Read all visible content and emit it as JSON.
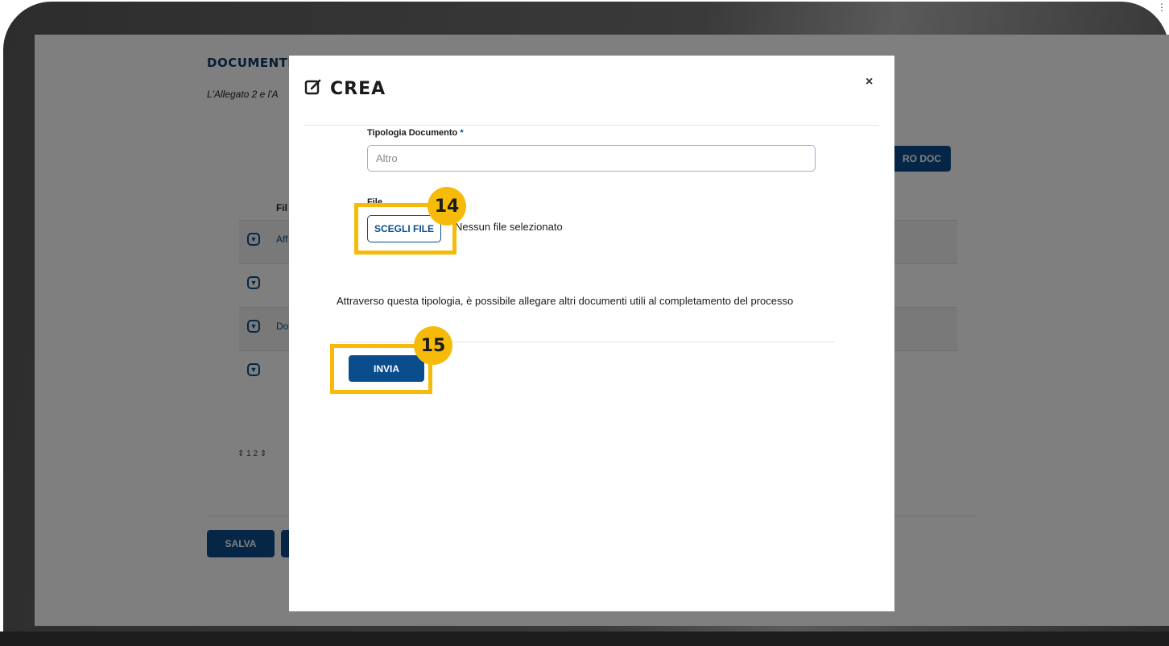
{
  "background": {
    "section_title": "DOCUMENTI",
    "subtitle": "L'Allegato 2 e l'A",
    "add_doc_button": "RO DOC",
    "table_header_fragment": "Fil",
    "rows": [
      {
        "text": "Aff"
      },
      {
        "text": ""
      },
      {
        "text": "Do"
      },
      {
        "text": ""
      }
    ],
    "pagination": "1 2",
    "save_button": "SALVA"
  },
  "modal": {
    "title": "CREA",
    "close_label": "×",
    "doc_type_label": "Tipologia Documento",
    "required_mark": "*",
    "doc_type_placeholder": "Altro",
    "file_label": "File",
    "choose_file_button": "SCEGLI FILE",
    "no_file_text": "Nessun file selezionato",
    "description": "Attraverso questa tipologia, è possibile allegare altri documenti utili al completamento del processo",
    "send_button": "INVIA"
  },
  "callouts": [
    {
      "number": "14"
    },
    {
      "number": "15"
    }
  ],
  "colors": {
    "accent": "#0a4d8c",
    "highlight": "#f6bb08",
    "overlay": "rgba(0,0,0,0.5)"
  }
}
